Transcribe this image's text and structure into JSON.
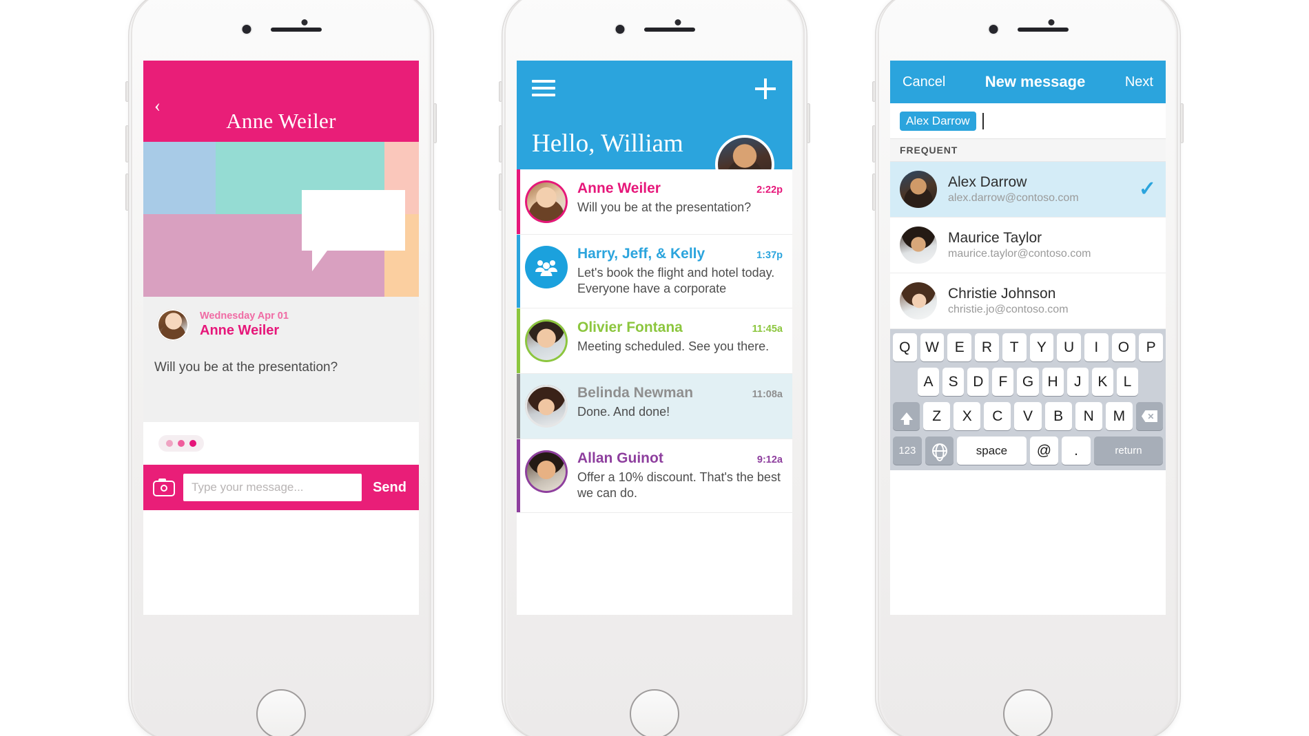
{
  "colors": {
    "pink": "#e91e78",
    "blue": "#2ba4dd",
    "green": "#8cc63e",
    "purple": "#8e3f9e",
    "gray": "#9a9a9a"
  },
  "phone1": {
    "back_icon": "‹",
    "title": "Anne Weiler",
    "message": {
      "date": "Wednesday Apr 01",
      "sender": "Anne Weiler",
      "body": "Will you be at the presentation?"
    },
    "typing_indicator": "typing-dots",
    "composer": {
      "camera_icon": "camera-icon",
      "input_value": "",
      "input_placeholder": "Type your message...",
      "send_label": "Send"
    }
  },
  "phone2": {
    "menu_icon": "hamburger-icon",
    "add_icon": "plus-icon",
    "greeting": "Hello, William",
    "avatar": "user-avatar",
    "conversations": [
      {
        "name": "Anne Weiler",
        "snippet": "Will you be at the presentation?",
        "time": "2:22p",
        "accent": "#e6177a",
        "read": false,
        "avatar_type": "photo"
      },
      {
        "name": "Harry, Jeff, & Kelly",
        "snippet": "Let's book the flight and hotel today. Everyone have a corporate",
        "time": "1:37p",
        "accent": "#2ba4dd",
        "read": false,
        "avatar_type": "group"
      },
      {
        "name": "Olivier Fontana",
        "snippet": "Meeting scheduled. See you there.",
        "time": "11:45a",
        "accent": "#8cc63e",
        "read": false,
        "avatar_type": "photo"
      },
      {
        "name": "Belinda Newman",
        "snippet": "Done. And done!",
        "time": "11:08a",
        "accent": "#8f8f8f",
        "read": true,
        "avatar_type": "photo"
      },
      {
        "name": "Allan Guinot",
        "snippet": "Offer a 10% discount. That's the best we can do.",
        "time": "9:12a",
        "accent": "#8e3f9e",
        "read": false,
        "avatar_type": "photo"
      }
    ]
  },
  "phone3": {
    "cancel_label": "Cancel",
    "title": "New message",
    "next_label": "Next",
    "recipient_token": "Alex Darrow",
    "section_label": "FREQUENT",
    "contacts": [
      {
        "name": "Alex Darrow",
        "email": "alex.darrow@contoso.com",
        "selected": true,
        "check_icon": "✓"
      },
      {
        "name": "Maurice Taylor",
        "email": "maurice.taylor@contoso.com",
        "selected": false,
        "check_icon": ""
      },
      {
        "name": "Christie Johnson",
        "email": "christie.jo@contoso.com",
        "selected": false,
        "check_icon": ""
      }
    ],
    "keyboard": {
      "row1": [
        "Q",
        "W",
        "E",
        "R",
        "T",
        "Y",
        "U",
        "I",
        "O",
        "P"
      ],
      "row2": [
        "A",
        "S",
        "D",
        "F",
        "G",
        "H",
        "J",
        "K",
        "L"
      ],
      "row3": [
        "Z",
        "X",
        "C",
        "V",
        "B",
        "N",
        "M"
      ],
      "shift_icon": "shift-icon",
      "backspace_icon": "backspace-icon",
      "numbers_label": "123",
      "globe_icon": "globe-icon",
      "space_label": "space",
      "at_label": "@",
      "period_label": ".",
      "return_label": "return"
    }
  }
}
